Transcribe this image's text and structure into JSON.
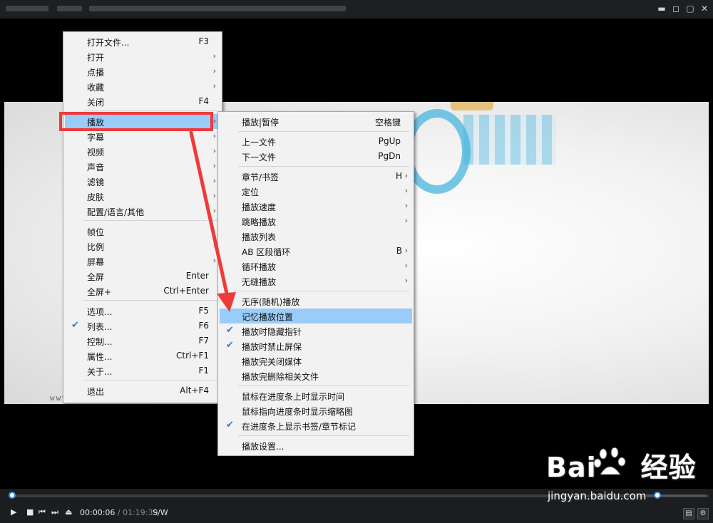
{
  "window": {
    "controls": [
      "▬",
      "◻",
      "▢",
      "✕"
    ]
  },
  "watermark": {
    "small": "www.xxxxxx",
    "brand": "Bai",
    "brand_cn": "经验",
    "url": "jingyan.baidu.com"
  },
  "menu_main": {
    "items": [
      {
        "label": "打开文件...",
        "shortcut": "F3"
      },
      {
        "label": "打开",
        "submenu": true
      },
      {
        "label": "点播",
        "submenu": true
      },
      {
        "label": "收藏",
        "submenu": true
      },
      {
        "label": "关闭",
        "shortcut": "F4"
      },
      {
        "label": "播放",
        "submenu": true,
        "highlighted": true
      },
      {
        "label": "字幕",
        "submenu": true
      },
      {
        "label": "视频",
        "submenu": true
      },
      {
        "label": "声音",
        "submenu": true
      },
      {
        "label": "滤镜",
        "submenu": true
      },
      {
        "label": "皮肤",
        "submenu": true
      },
      {
        "label": "配置/语言/其他",
        "submenu": true
      },
      {
        "label": "帧位"
      },
      {
        "label": "比例",
        "submenu": true
      },
      {
        "label": "屏幕",
        "submenu": true
      },
      {
        "label": "全屏",
        "shortcut": "Enter"
      },
      {
        "label": "全屏+",
        "shortcut": "Ctrl+Enter"
      },
      {
        "label": "选项...",
        "shortcut": "F5"
      },
      {
        "label": "列表...",
        "shortcut": "F6",
        "checked": true
      },
      {
        "label": "控制...",
        "shortcut": "F7"
      },
      {
        "label": "属性...",
        "shortcut": "Ctrl+F1"
      },
      {
        "label": "关于...",
        "shortcut": "F1"
      },
      {
        "label": "退出",
        "shortcut": "Alt+F4"
      }
    ]
  },
  "menu_play": {
    "items": [
      {
        "label": "播放|暂停",
        "shortcut": "空格键"
      },
      {
        "label": "上一文件",
        "shortcut": "PgUp"
      },
      {
        "label": "下一文件",
        "shortcut": "PgDn"
      },
      {
        "label": "章节/书签",
        "shortcut": "H",
        "submenu": true
      },
      {
        "label": "定位",
        "submenu": true
      },
      {
        "label": "播放速度",
        "submenu": true
      },
      {
        "label": "跳略播放",
        "submenu": true
      },
      {
        "label": "播放列表"
      },
      {
        "label": "AB 区段循环",
        "shortcut": "B",
        "submenu": true
      },
      {
        "label": "循环播放",
        "submenu": true
      },
      {
        "label": "无缝播放",
        "submenu": true
      },
      {
        "label": "无序(随机)播放"
      },
      {
        "label": "记忆播放位置",
        "highlighted": true
      },
      {
        "label": "播放时隐藏指针",
        "checked": true
      },
      {
        "label": "播放时禁止屏保",
        "checked": true
      },
      {
        "label": "播放完关闭媒体"
      },
      {
        "label": "播放完删除相关文件"
      },
      {
        "label": "鼠标在进度条上时显示时间"
      },
      {
        "label": "鼠标指向进度条时显示缩略图"
      },
      {
        "label": "在进度条上显示书签/章节标记",
        "checked": true
      },
      {
        "label": "播放设置..."
      }
    ]
  },
  "player": {
    "current_time": "00:00:06",
    "total_time": " / 01:19:39",
    "mode": "S/W",
    "progress_fraction": 0.001,
    "volume_fraction": 0.2
  },
  "icons": {
    "submenu_arrow": "›",
    "check": "✔",
    "play": "▶",
    "stop": "■",
    "prev": "⏮",
    "next": "⏭",
    "eject": "⏏"
  }
}
